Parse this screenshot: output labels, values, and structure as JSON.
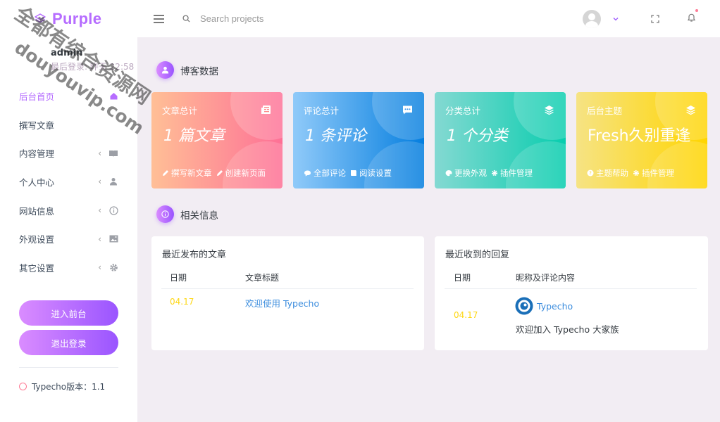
{
  "brand": {
    "name": "Purple"
  },
  "search": {
    "placeholder": "Search projects"
  },
  "watermark": {
    "line1": "全都有综合资源网",
    "line2": "douyouvip.com"
  },
  "profile": {
    "name": "admin",
    "last_login": "最后登录: 昨天 22:58"
  },
  "sidebar": {
    "items": [
      {
        "label": "后台首页",
        "icon": "home-icon",
        "has_arrow": false
      },
      {
        "label": "撰写文章",
        "icon": "",
        "has_arrow": false
      },
      {
        "label": "内容管理",
        "icon": "book-icon",
        "has_arrow": true
      },
      {
        "label": "个人中心",
        "icon": "user-icon",
        "has_arrow": true
      },
      {
        "label": "网站信息",
        "icon": "info-icon",
        "has_arrow": true
      },
      {
        "label": "外观设置",
        "icon": "image-icon",
        "has_arrow": true
      },
      {
        "label": "其它设置",
        "icon": "gear-icon",
        "has_arrow": true
      }
    ],
    "buttons": {
      "frontend": "进入前台",
      "logout": "退出登录"
    },
    "version": "Typecho版本：1.1"
  },
  "sections": {
    "blog_data": "博客数据",
    "related_info": "相关信息"
  },
  "cards": [
    {
      "title": "文章总计",
      "value": "1 篇文章",
      "icon": "newspaper-icon",
      "links": [
        "撰写新文章",
        "创建新页面"
      ],
      "link_icons": [
        "pencil-icon",
        "pencil-icon"
      ]
    },
    {
      "title": "评论总计",
      "value": "1 条评论",
      "icon": "comment-icon",
      "links": [
        "全部评论",
        "阅读设置"
      ],
      "link_icons": [
        "chat-icon",
        "book-icon"
      ]
    },
    {
      "title": "分类总计",
      "value": "1 个分类",
      "icon": "layers-icon",
      "links": [
        "更换外观",
        "插件管理"
      ],
      "link_icons": [
        "palette-icon",
        "gear-icon"
      ]
    },
    {
      "title": "后台主题",
      "value": "Fresh久别重逢",
      "icon": "layers-icon",
      "links": [
        "主题帮助",
        "插件管理"
      ],
      "link_icons": [
        "help-icon",
        "gear-icon"
      ]
    }
  ],
  "recent_posts": {
    "title": "最近发布的文章",
    "headers": [
      "日期",
      "文章标题"
    ],
    "rows": [
      {
        "date": "04.17",
        "title": "欢迎使用 Typecho"
      }
    ]
  },
  "recent_replies": {
    "title": "最近收到的回复",
    "headers": [
      "日期",
      "昵称及评论内容"
    ],
    "rows": [
      {
        "date": "04.17",
        "author": "Typecho",
        "content": "欢迎加入 Typecho 大家族"
      }
    ]
  },
  "colors": {
    "accent": "#b66dff",
    "card_orange": "#fe7096",
    "card_blue": "#047edf",
    "card_teal": "#07cdae",
    "card_yellow": "#ffd500",
    "date_yellow": "#fed713",
    "link_blue": "#3c8dde"
  }
}
